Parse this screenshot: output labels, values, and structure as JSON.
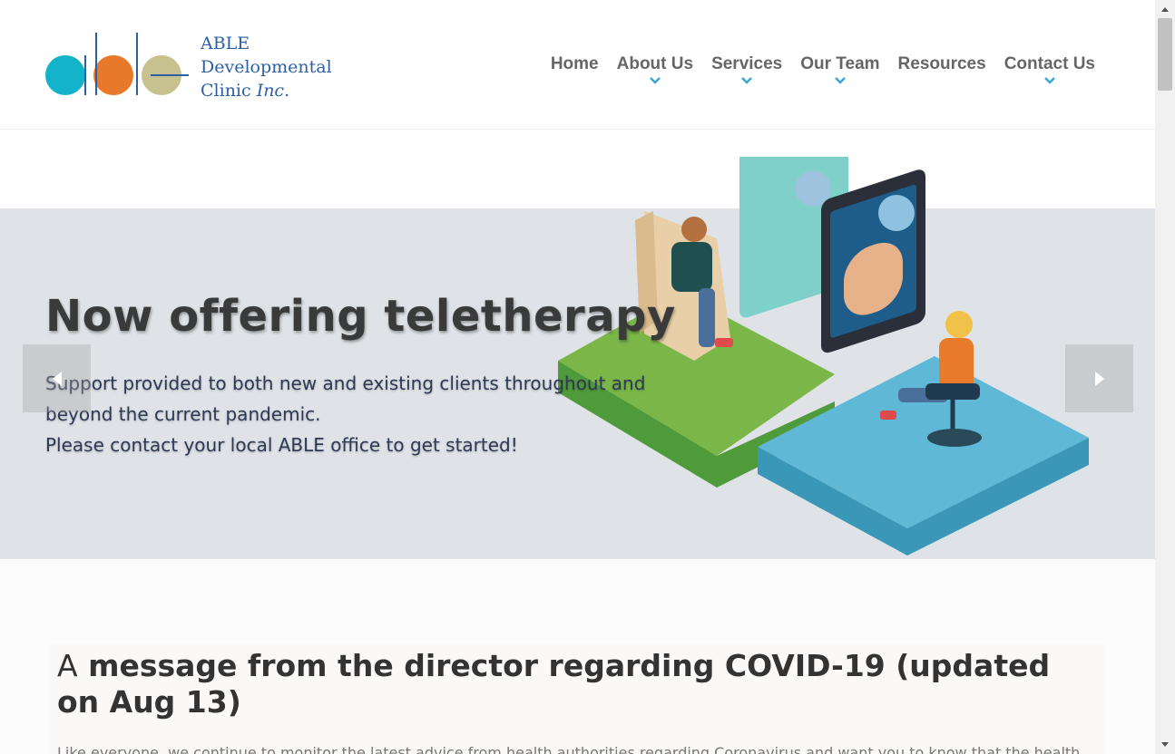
{
  "logo": {
    "line1": "ABLE",
    "line2": "Developmental",
    "line3_main": "Clinic ",
    "line3_italic": "Inc."
  },
  "nav": {
    "items": [
      {
        "label": "Home",
        "has_dropdown": false
      },
      {
        "label": "About Us",
        "has_dropdown": true
      },
      {
        "label": "Services",
        "has_dropdown": true
      },
      {
        "label": "Our Team",
        "has_dropdown": true
      },
      {
        "label": "Resources",
        "has_dropdown": false
      },
      {
        "label": "Contact Us",
        "has_dropdown": true
      }
    ]
  },
  "hero": {
    "title": "Now offering teletherapy",
    "sub_line1": "Support provided to both new and existing clients throughout and beyond the current pandemic.",
    "sub_line2": "Please contact your local ABLE office to get started!"
  },
  "message": {
    "title_first": "A",
    "title_rest": " message from the director regarding COVID-19 (updated on Aug 13)",
    "body": "Like everyone, we continue to monitor the latest advice from health authorities regarding Coronavirus and want you to know that the health"
  },
  "colors": {
    "accent": "#3aa6d8",
    "logo_blue": "#2d5fa3",
    "circle_teal": "#13b3c9",
    "circle_orange": "#e8792a",
    "circle_olive": "#c6c18f",
    "nav_text": "#666666",
    "hero_band": "#dfe3e7"
  },
  "icons": {
    "prev": "chevron-left-icon",
    "next": "chevron-right-icon",
    "dropdown": "chevron-down-icon"
  }
}
